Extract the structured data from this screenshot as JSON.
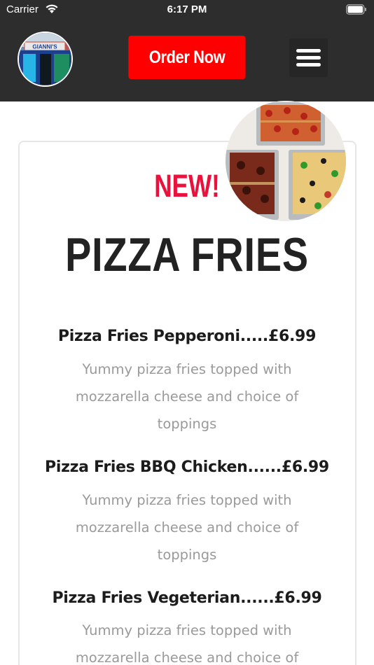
{
  "status_bar": {
    "carrier": "Carrier",
    "time": "6:17 PM"
  },
  "header": {
    "logo_text": "GIANNI'S",
    "order_button": "Order Now",
    "menu_icon": "hamburger-icon"
  },
  "section": {
    "badge": "NEW!",
    "title": "PIZZA FRIES"
  },
  "menu_items": [
    {
      "name": "Pizza Fries Pepperoni.....£6.99",
      "description": "Yummy pizza fries topped with mozzarella cheese and choice of toppings"
    },
    {
      "name": "Pizza Fries BBQ Chicken......£6.99",
      "description": "Yummy pizza fries topped with mozzarella cheese and choice of toppings"
    },
    {
      "name": "Pizza Fries Vegeterian......£6.99",
      "description": "Yummy pizza fries topped with mozzarella cheese and choice of"
    }
  ],
  "colors": {
    "header_bg": "#2d2d2d",
    "order_button_bg": "#ff0000",
    "badge_color": "#e8123d",
    "title_color": "#222222",
    "description_color": "#9a9a9a"
  }
}
